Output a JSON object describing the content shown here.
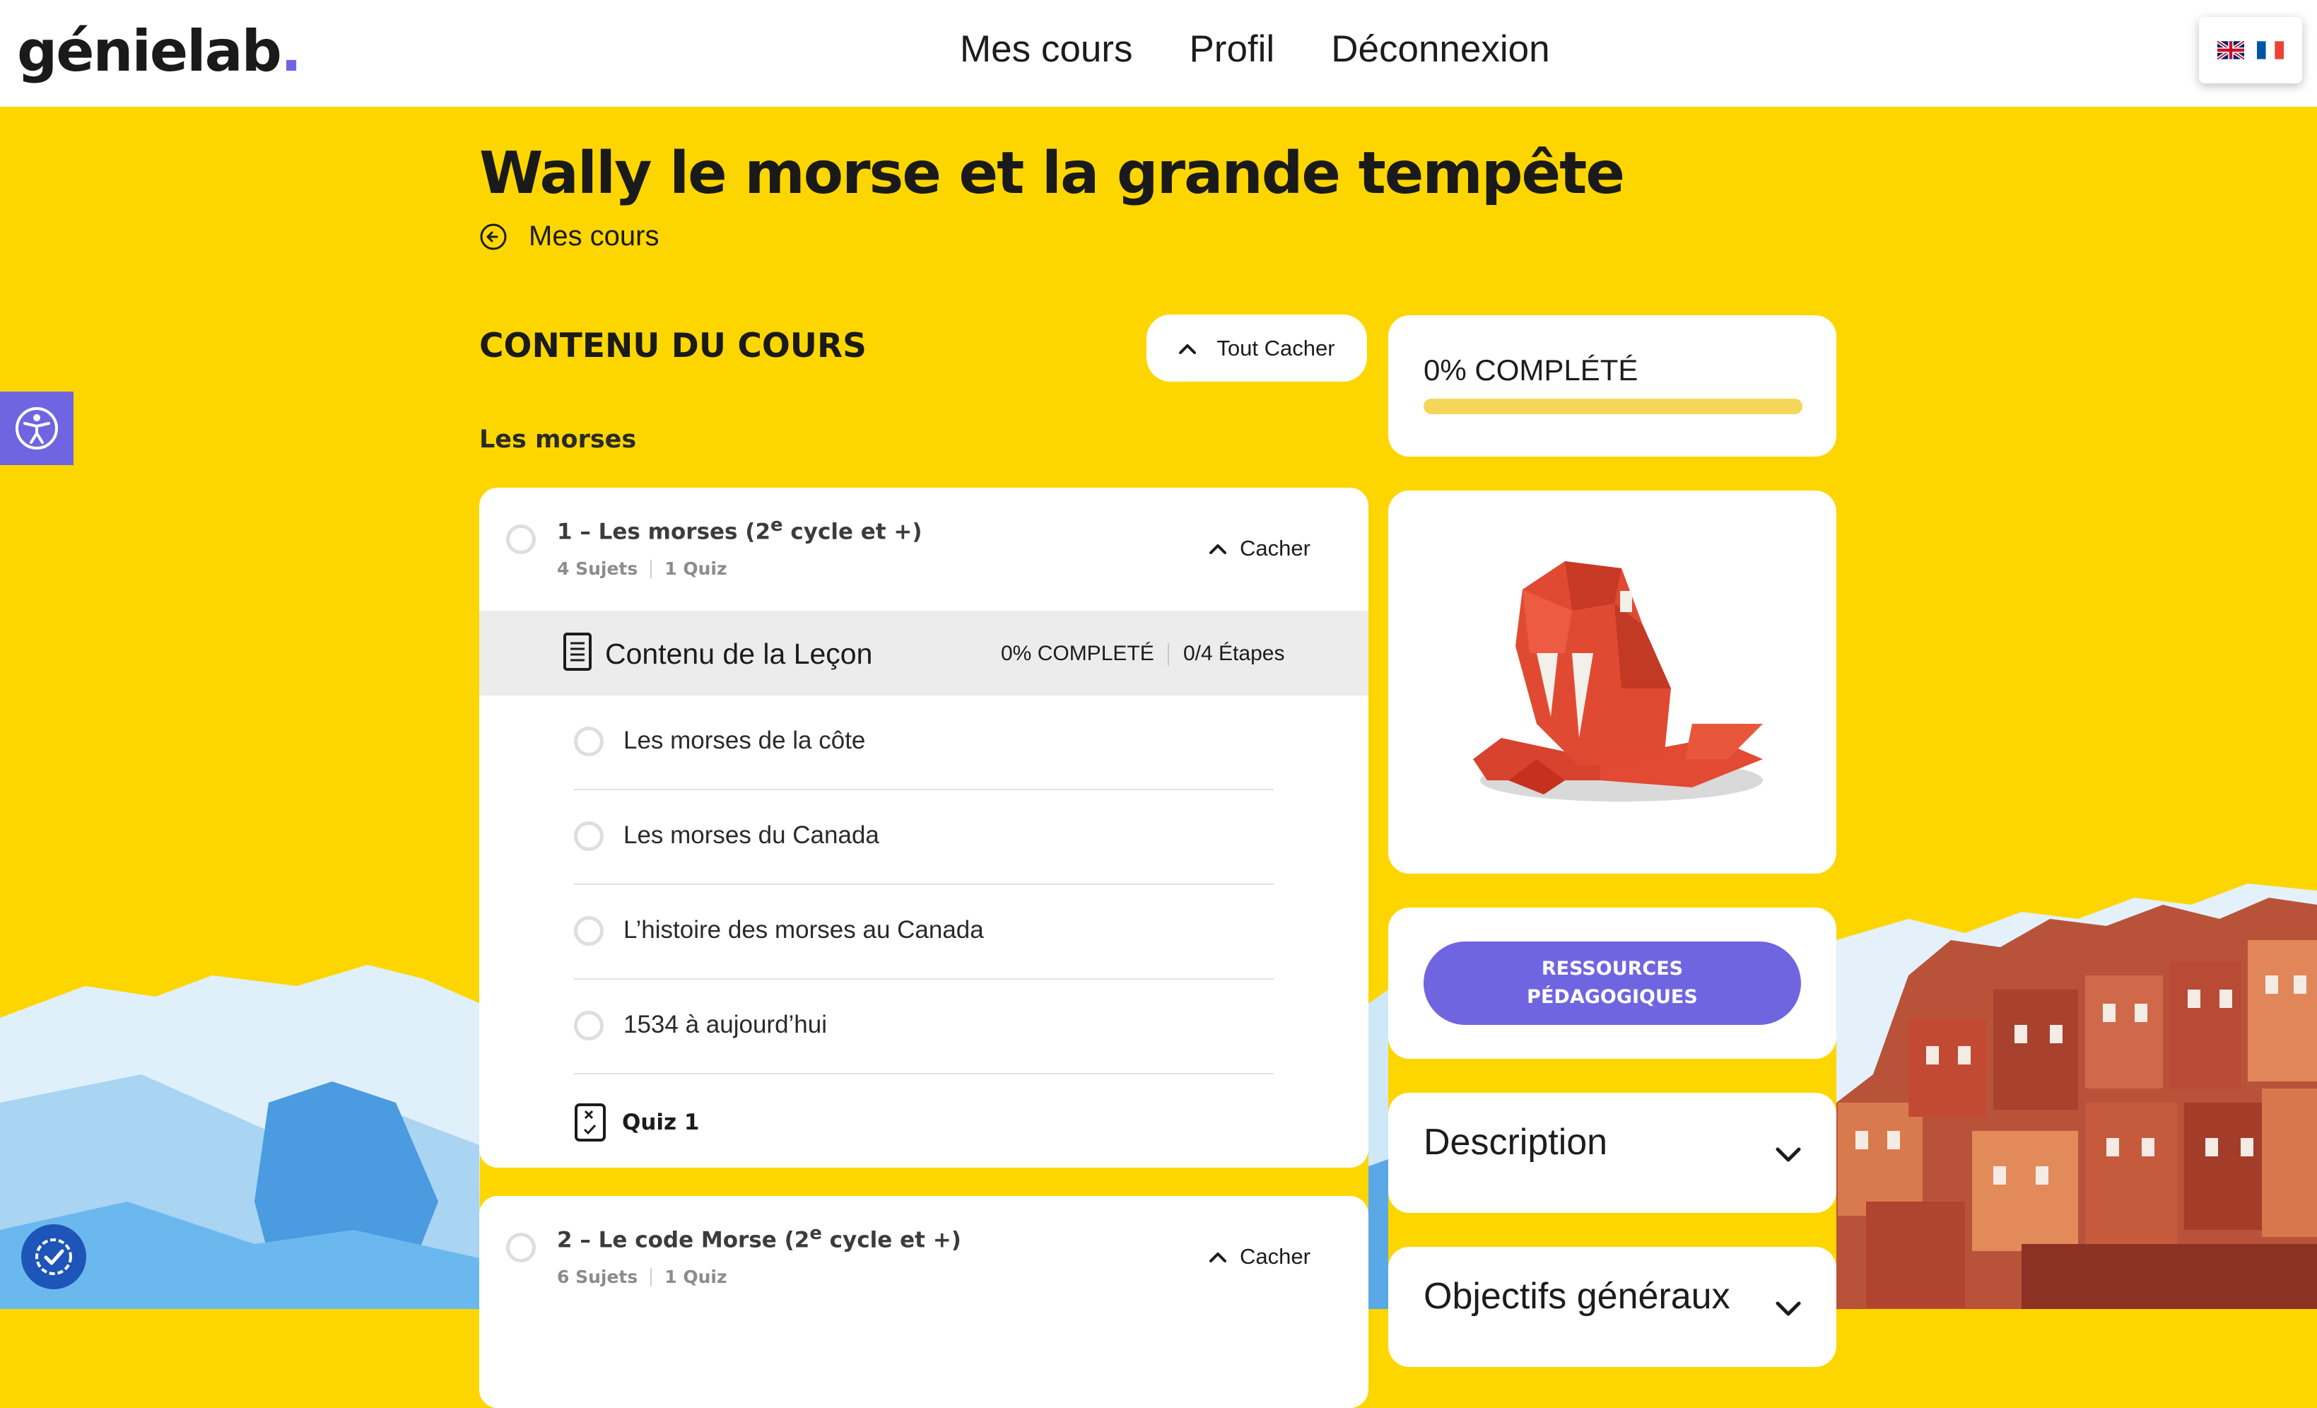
{
  "brand": {
    "name": "génielab",
    "dot": ".",
    "accent": "#7065e0"
  },
  "header": {
    "nav": [
      "Mes cours",
      "Profil",
      "Déconnexion"
    ],
    "languages": [
      "English flag",
      "French flag"
    ]
  },
  "page": {
    "title": "Wally le morse et la grande tempête",
    "back_label": "Mes cours",
    "background": "#fdd600"
  },
  "course": {
    "section_title": "CONTENU DU COURS",
    "toggle_all_label": "Tout Cacher",
    "group_title": "Les morses",
    "lessons": [
      {
        "title_main": "1 – Les morses (2",
        "title_sup": "e",
        "title_end": " cycle et +)",
        "topics_count": "4 Sujets",
        "quiz_count": "1 Quiz",
        "hide_label": "Cacher",
        "content_title": "Contenu de la Leçon",
        "content_progress": "0% COMPLETÉ",
        "content_steps": "0/4 Étapes",
        "topics": [
          "Les morses de la côte",
          "Les morses du Canada",
          "L’histoire des morses au Canada",
          "1534 à aujourd’hui"
        ],
        "quiz_label": "Quiz 1"
      },
      {
        "title_main": "2 – Le code Morse (2",
        "title_sup": "e",
        "title_end": " cycle et +)",
        "topics_count": "6 Sujets",
        "quiz_count": "1 Quiz",
        "hide_label": "Cacher"
      }
    ]
  },
  "sidebar": {
    "progress_label": "0% COMPLÉTÉ",
    "progress_fraction": 0,
    "resources_line1": "RESSOURCES",
    "resources_line2": "PÉDAGOGIQUES",
    "accordions": [
      "Description",
      "Objectifs généraux"
    ]
  },
  "widgets": {
    "accessibility_icon": "accessibility-icon",
    "consent_icon": "cookie-consent-icon"
  }
}
